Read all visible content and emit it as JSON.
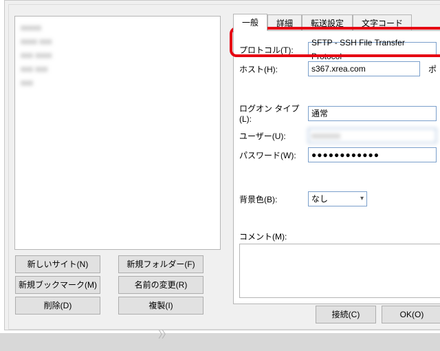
{
  "tabs": {
    "general": "一般",
    "advanced": "詳細",
    "transfer": "転送設定",
    "charset": "文字コード"
  },
  "labels": {
    "protocol": "プロトコル(T):",
    "host": "ホスト(H):",
    "port": "ポ",
    "logon_type": "ログオン タイプ(L):",
    "user": "ユーザー(U):",
    "password": "パスワード(W):",
    "bgcolor": "背景色(B):",
    "comment": "コメント(M):"
  },
  "values": {
    "protocol": "SFTP - SSH File Transfer Protocol",
    "host": "s367.xrea.com",
    "logon_type": "通常",
    "user": "xxxxxxx",
    "password": "●●●●●●●●●●●●",
    "bgcolor": "なし"
  },
  "left_buttons": {
    "new_site": "新しいサイト(N)",
    "new_folder": "新規フォルダー(F)",
    "new_bookmark": "新規ブックマーク(M)",
    "rename": "名前の変更(R)",
    "delete": "削除(D)",
    "duplicate": "複製(I)"
  },
  "bottom_buttons": {
    "connect": "接続(C)",
    "ok": "OK(O)"
  },
  "site_list_placeholder": [
    "item",
    "item",
    "item",
    "item",
    "item"
  ]
}
